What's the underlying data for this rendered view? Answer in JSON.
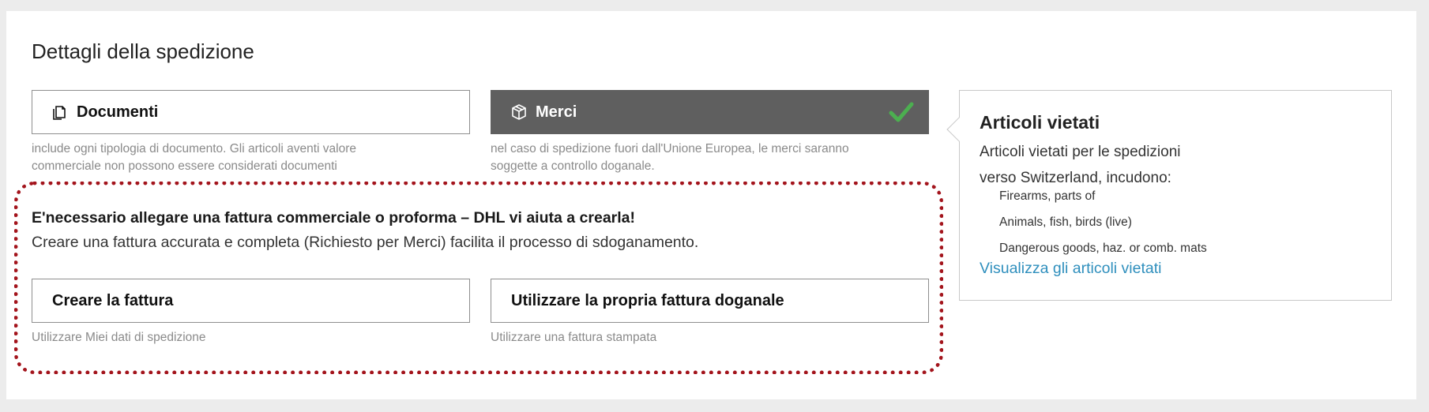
{
  "section": {
    "title": "Dettagli della spedizione"
  },
  "shipment_types": [
    {
      "label": "Documenti",
      "icon": "documents-icon",
      "selected": false,
      "hint_line1": "include ogni tipologia di documento. Gli articoli aventi valore",
      "hint_line2": "commerciale non possono essere considerati documenti"
    },
    {
      "label": "Merci",
      "icon": "package-icon",
      "selected": true,
      "hint_line1": "nel caso di spedizione fuori dall'Unione Europea, le merci saranno",
      "hint_line2": "soggette a controllo doganale."
    }
  ],
  "invoice_notice": {
    "bold": "E'necessario allegare una fattura commerciale o proforma – DHL vi aiuta a crearla!",
    "text": "Creare una fattura accurata e completa (Richiesto per Merci) facilita il processo di sdoganamento."
  },
  "invoice_options": [
    {
      "label": "Creare la fattura",
      "hint": "Utilizzare Miei dati di spedizione"
    },
    {
      "label": "Utilizzare la propria fattura doganale",
      "hint": "Utilizzare una fattura stampata"
    }
  ],
  "prohibited_panel": {
    "title": "Articoli vietati",
    "description": "Articoli vietati per le spedizioni verso Switzerland, incudono:",
    "items": [
      "Firearms, parts of",
      "Animals, fish, birds (live)",
      "Dangerous goods, haz. or comb. mats"
    ],
    "link": "Visualizza gli articoli vietati"
  },
  "colors": {
    "selected_bg": "#5f5f5f",
    "check_green": "#4caf50",
    "link": "#2f8fbd",
    "highlight_border": "#a3141c"
  }
}
